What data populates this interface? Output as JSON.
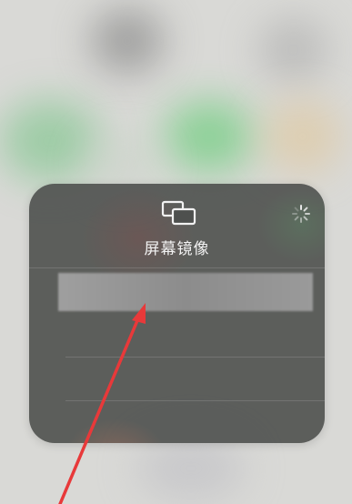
{
  "panel": {
    "title": "屏幕镜像",
    "icon": "screen-mirroring-icon",
    "spinner_icon": "loading-spinner-icon",
    "device_list": [
      {
        "label": ""
      },
      {
        "label": ""
      },
      {
        "label": ""
      }
    ]
  },
  "annotation": {
    "type": "red-arrow",
    "color": "#e8393a"
  },
  "colors": {
    "panel_background": "#4e504e",
    "title_text": "#f2f2f2",
    "selected_row": "#9a9a9a"
  }
}
